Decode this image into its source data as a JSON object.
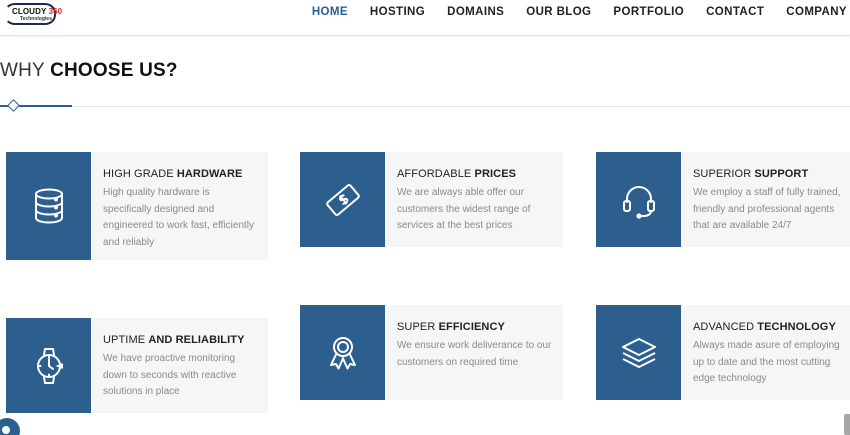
{
  "logo": {
    "text_main": "CLOUDY ",
    "text_accent": "360",
    "text_sub": "Technologies"
  },
  "nav": {
    "items": [
      {
        "label": "HOME",
        "active": true
      },
      {
        "label": "HOSTING",
        "active": false
      },
      {
        "label": "DOMAINS",
        "active": false
      },
      {
        "label": "OUR BLOG",
        "active": false
      },
      {
        "label": "PORTFOLIO",
        "active": false
      },
      {
        "label": "CONTACT",
        "active": false
      },
      {
        "label": "COMPANY",
        "active": false
      }
    ]
  },
  "section": {
    "title_light": "WHY ",
    "title_bold": "CHOOSE US?"
  },
  "features": [
    {
      "icon": "database-icon",
      "title_light": "HIGH GRADE ",
      "title_bold": "HARDWARE",
      "description": "High quality hardware is specifically designed and engineered to work fast, efficiently and reliably"
    },
    {
      "icon": "money-tag-icon",
      "title_light": "AFFORDABLE ",
      "title_bold": "PRICES",
      "description": "We are always able offer our customers the widest range of services at the best prices"
    },
    {
      "icon": "headset-icon",
      "title_light": "SUPERIOR ",
      "title_bold": "SUPPORT",
      "description": "We employ a staff of fully trained, friendly and professional agents that are available 24/7"
    },
    {
      "icon": "watch-icon",
      "title_light": "UPTIME ",
      "title_bold": "AND RELIABILITY",
      "description": "We have proactive monitoring down to seconds with reactive solutions in place"
    },
    {
      "icon": "award-icon",
      "title_light": "SUPER ",
      "title_bold": "EFFICIENCY",
      "description": "We ensure work deliverance to our customers on required time"
    },
    {
      "icon": "layers-icon",
      "title_light": "ADVANCED ",
      "title_bold": "TECHNOLOGY",
      "description": "Always made asure of employing up to date and the most cutting edge technology"
    }
  ],
  "colors": {
    "accent": "#2c5f8e",
    "nav_active": "#2a5e92",
    "card_bg": "#f5f6f8",
    "text_muted": "#8a8a8a"
  }
}
